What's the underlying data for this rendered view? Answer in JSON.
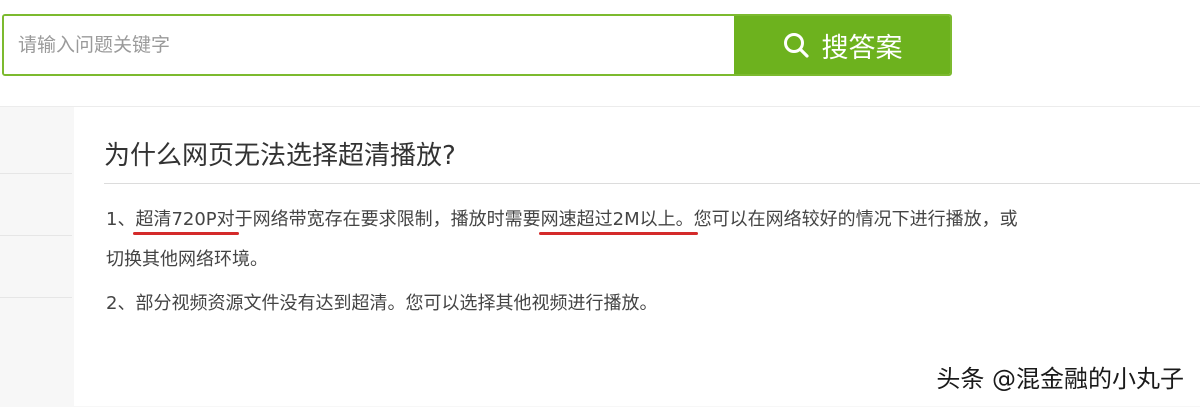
{
  "search": {
    "placeholder": "请输入问题关键字",
    "button_label": "搜答案",
    "accent_color": "#6db21e",
    "button_icon": "search-icon"
  },
  "question": {
    "title": "为什么网页无法选择超清播放?"
  },
  "answer": {
    "line1": {
      "prefix": "1、",
      "highlight_a": "超清720P对",
      "middle": "于网络带宽存在要求限制，播放时需要",
      "highlight_b": "网速超过2M以上。",
      "suffix": "您可以在网络较好的情况下进行播放，或"
    },
    "line1_cont": "切换其他网络环境。",
    "line2": "2、部分视频资源文件没有达到超清。您可以选择其他视频进行播放。",
    "highlight_color": "#d42a2a"
  },
  "watermark": "头条 @混金融的小丸子"
}
